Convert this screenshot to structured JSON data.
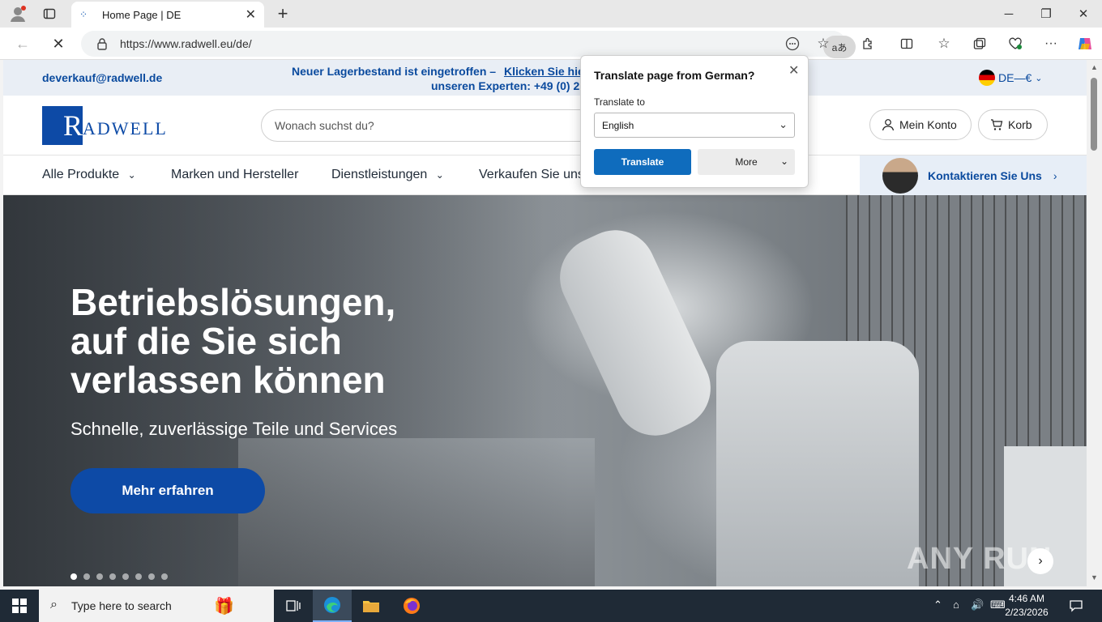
{
  "browser": {
    "tab_title": "Home Page | DE",
    "url": "https://www.radwell.eu/de/",
    "translate_icon": "aあ"
  },
  "site": {
    "email": "deverkauf@radwell.de",
    "promo_line1_text": "Neuer Lagerbestand ist eingetroffen –",
    "promo_line1_link": "Klicken Sie hie",
    "promo_line2": "unseren Experten:  +49 (0) 2",
    "lang_currency": "DE—€",
    "logo_letter": "R",
    "logo_rest": "ADWELL",
    "search_placeholder": "Wonach suchst du?",
    "account_label": "Mein Konto",
    "cart_label": "Korb",
    "nav": {
      "all_products": "Alle Produkte",
      "brands": "Marken und Hersteller",
      "services": "Dienstleistungen",
      "sell": "Verkaufen Sie uns"
    },
    "contact_label": "Kontaktieren Sie Uns",
    "hero": {
      "title_line1": "Betriebslösungen,",
      "title_line2": "auf die Sie sich",
      "title_line3": "verlassen können",
      "subtitle": "Schnelle, zuverlässige Teile und Services",
      "cta": "Mehr erfahren",
      "slide_count": 8,
      "active_slide": 1,
      "watermark": "ANY RUN"
    }
  },
  "translate_popup": {
    "title": "Translate page from German?",
    "translate_to_label": "Translate to",
    "selected_language": "English",
    "translate_button": "Translate",
    "more_button": "More"
  },
  "taskbar": {
    "search_placeholder": "Type here to search",
    "time": "4:46 AM",
    "date": "2/23/2026"
  },
  "colors": {
    "brand_blue": "#0d4aa6",
    "link_blue": "#0a4a9e",
    "translate_blue": "#0f6cbd",
    "taskbar": "#1f2a36"
  }
}
